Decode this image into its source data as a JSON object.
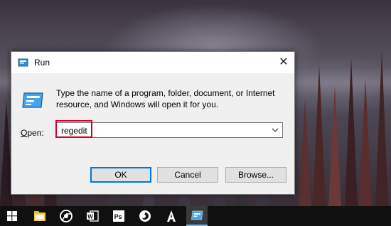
{
  "dialog": {
    "title": "Run",
    "description": "Type the name of a program, folder, document, or Internet resource, and Windows will open it for you.",
    "open_label_prefix": "O",
    "open_label_rest": "pen:",
    "open_value": "regedit",
    "ok_label": "OK",
    "cancel_label": "Cancel",
    "browse_label": "Browse...",
    "close_glyph": "✕"
  },
  "taskbar": {
    "items": [
      {
        "icon": "windows-start-icon"
      },
      {
        "icon": "file-explorer-icon"
      },
      {
        "icon": "chrome-icon"
      },
      {
        "icon": "word-icon"
      },
      {
        "icon": "photoshop-icon"
      },
      {
        "icon": "firefox-icon"
      },
      {
        "icon": "font-a-icon"
      },
      {
        "icon": "run-icon"
      }
    ]
  },
  "colors": {
    "highlight": "#d4002a",
    "accent": "#0078d7",
    "taskbar": "#101010"
  }
}
